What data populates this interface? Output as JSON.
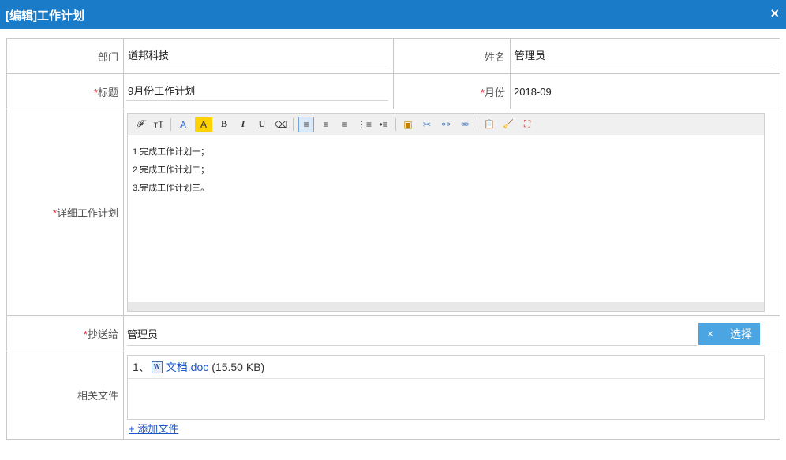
{
  "window": {
    "title": "[编辑]工作计划",
    "close": "×"
  },
  "form": {
    "department": {
      "label": "部门",
      "value": "道邦科技"
    },
    "name": {
      "label": "姓名",
      "value": "管理员"
    },
    "subject": {
      "required": "*",
      "label": "标题",
      "value": "9月份工作计划"
    },
    "month": {
      "required": "*",
      "label": "月份",
      "value": "2018-09"
    },
    "detail": {
      "required": "*",
      "label": "详细工作计划",
      "lines": [
        "1.完成工作计划一；",
        "2.完成工作计划二；",
        "3.完成工作计划三。"
      ]
    },
    "cc": {
      "required": "*",
      "label": "抄送给",
      "value": "管理员",
      "clear": "×",
      "select": "选择"
    },
    "files": {
      "label": "相关文件",
      "index": "1、",
      "icon_text": "W",
      "filename": "文档.doc",
      "size": "(15.50 KB)",
      "add": "+ 添加文件"
    }
  },
  "toolbar": {
    "font_family": "𝓕",
    "font_size": "тT",
    "font_color": "A",
    "bg_color": "A",
    "bold": "B",
    "italic": "I",
    "underline": "U",
    "eraser": "⌫",
    "align_left": "≡",
    "align_center": "≡",
    "align_right": "≡",
    "ordered_list": "⋮≡",
    "unordered_list": "•≡",
    "image": "▣",
    "cut": "✂",
    "link": "⚯",
    "unlink": "⚮",
    "paste": "📋",
    "clean": "🧹",
    "fullscreen": "⛶"
  },
  "colors": {
    "titlebar": "#1a7bc9",
    "required": "#e23",
    "button": "#4ba5e2",
    "link": "#1e57c8"
  }
}
